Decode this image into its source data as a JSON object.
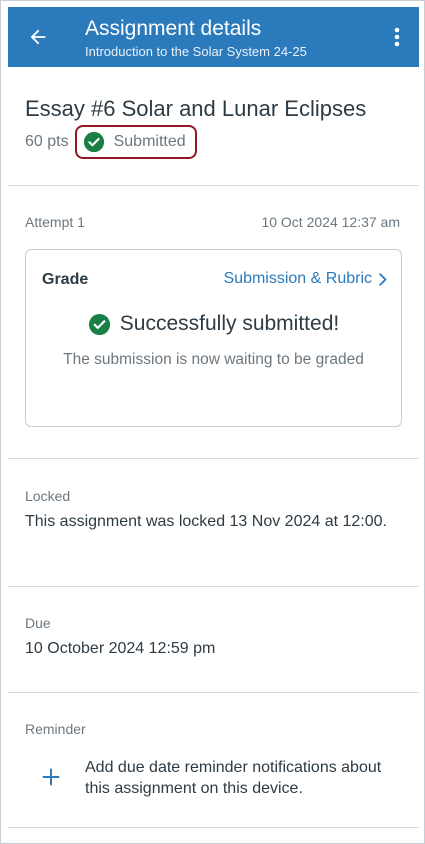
{
  "app_bar": {
    "title": "Assignment details",
    "subtitle": "Introduction to the Solar System  24-25",
    "color": "#2b7abc"
  },
  "assignment": {
    "title": "Essay #6 Solar and Lunar Eclipses",
    "points": "60 pts",
    "status": "Submitted",
    "status_icon": "check-circle-icon",
    "status_color": "#1a7f45",
    "highlight_color": "#8e1b23"
  },
  "attempt": {
    "label": "Attempt 1",
    "date": "10 Oct 2024 12:37 am"
  },
  "grade_card": {
    "label": "Grade",
    "link": "Submission & Rubric",
    "success": "Successfully submitted!",
    "waiting": "The submission is now waiting to be graded"
  },
  "locked": {
    "label": "Locked",
    "value": "This assignment was locked 13 Nov 2024 at 12:00."
  },
  "due": {
    "label": "Due",
    "value": "10 October 2024 12:59 pm"
  },
  "reminder": {
    "label": "Reminder",
    "action": "Add due date reminder notifications about this assignment on this device."
  }
}
